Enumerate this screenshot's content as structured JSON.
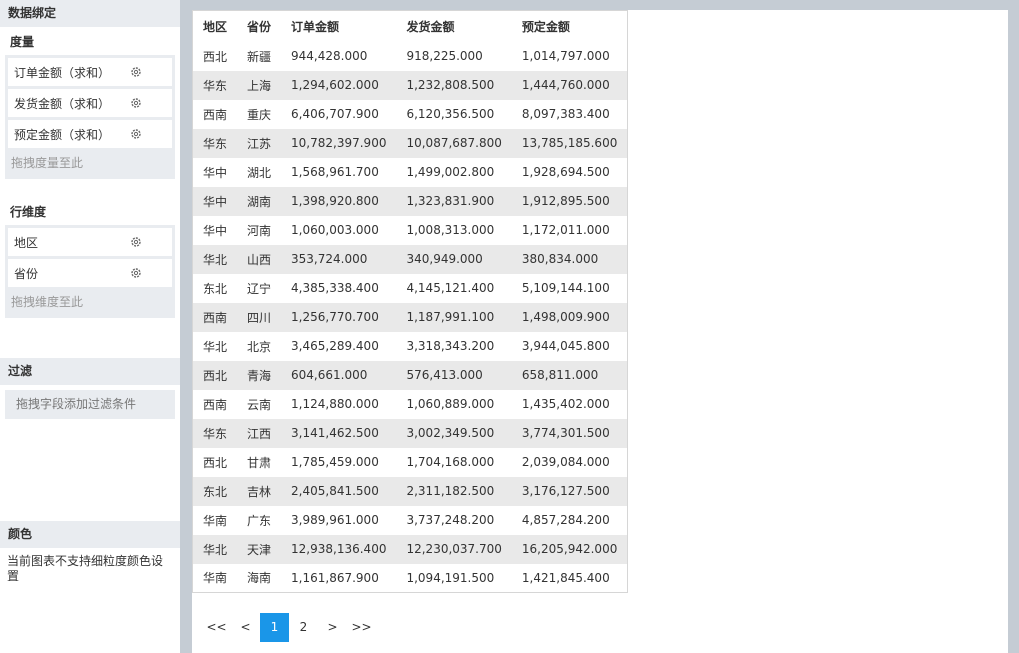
{
  "sidebar": {
    "title": "数据绑定",
    "measures": {
      "label": "度量",
      "fields": [
        "订单金额（求和）",
        "发货金额（求和）",
        "预定金额（求和）"
      ],
      "drop_hint": "拖拽度量至此"
    },
    "row_dims": {
      "label": "行维度",
      "fields": [
        "地区",
        "省份"
      ],
      "drop_hint": "拖拽维度至此"
    },
    "filter": {
      "label": "过滤",
      "drop_hint": "拖拽字段添加过滤条件"
    },
    "color": {
      "label": "颜色",
      "note": "当前图表不支持细粒度颜色设置"
    }
  },
  "table": {
    "headers": [
      "地区",
      "省份",
      "订单金额",
      "发货金额",
      "预定金额"
    ],
    "rows": [
      [
        "西北",
        "新疆",
        "944,428.000",
        "918,225.000",
        "1,014,797.000"
      ],
      [
        "华东",
        "上海",
        "1,294,602.000",
        "1,232,808.500",
        "1,444,760.000"
      ],
      [
        "西南",
        "重庆",
        "6,406,707.900",
        "6,120,356.500",
        "8,097,383.400"
      ],
      [
        "华东",
        "江苏",
        "10,782,397.900",
        "10,087,687.800",
        "13,785,185.600"
      ],
      [
        "华中",
        "湖北",
        "1,568,961.700",
        "1,499,002.800",
        "1,928,694.500"
      ],
      [
        "华中",
        "湖南",
        "1,398,920.800",
        "1,323,831.900",
        "1,912,895.500"
      ],
      [
        "华中",
        "河南",
        "1,060,003.000",
        "1,008,313.000",
        "1,172,011.000"
      ],
      [
        "华北",
        "山西",
        "353,724.000",
        "340,949.000",
        "380,834.000"
      ],
      [
        "东北",
        "辽宁",
        "4,385,338.400",
        "4,145,121.400",
        "5,109,144.100"
      ],
      [
        "西南",
        "四川",
        "1,256,770.700",
        "1,187,991.100",
        "1,498,009.900"
      ],
      [
        "华北",
        "北京",
        "3,465,289.400",
        "3,318,343.200",
        "3,944,045.800"
      ],
      [
        "西北",
        "青海",
        "604,661.000",
        "576,413.000",
        "658,811.000"
      ],
      [
        "西南",
        "云南",
        "1,124,880.000",
        "1,060,889.000",
        "1,435,402.000"
      ],
      [
        "华东",
        "江西",
        "3,141,462.500",
        "3,002,349.500",
        "3,774,301.500"
      ],
      [
        "西北",
        "甘肃",
        "1,785,459.000",
        "1,704,168.000",
        "2,039,084.000"
      ],
      [
        "东北",
        "吉林",
        "2,405,841.500",
        "2,311,182.500",
        "3,176,127.500"
      ],
      [
        "华南",
        "广东",
        "3,989,961.000",
        "3,737,248.200",
        "4,857,284.200"
      ],
      [
        "华北",
        "天津",
        "12,938,136.400",
        "12,230,037.700",
        "16,205,942.000"
      ],
      [
        "华南",
        "海南",
        "1,161,867.900",
        "1,094,191.500",
        "1,421,845.400"
      ]
    ]
  },
  "pager": {
    "first": "<<",
    "prev": "<",
    "pages": [
      "1",
      "2"
    ],
    "current": "1",
    "next": ">",
    "last": ">>",
    "accent": "#1a96e8"
  },
  "icons": {
    "field_settings": "gear-icon"
  }
}
